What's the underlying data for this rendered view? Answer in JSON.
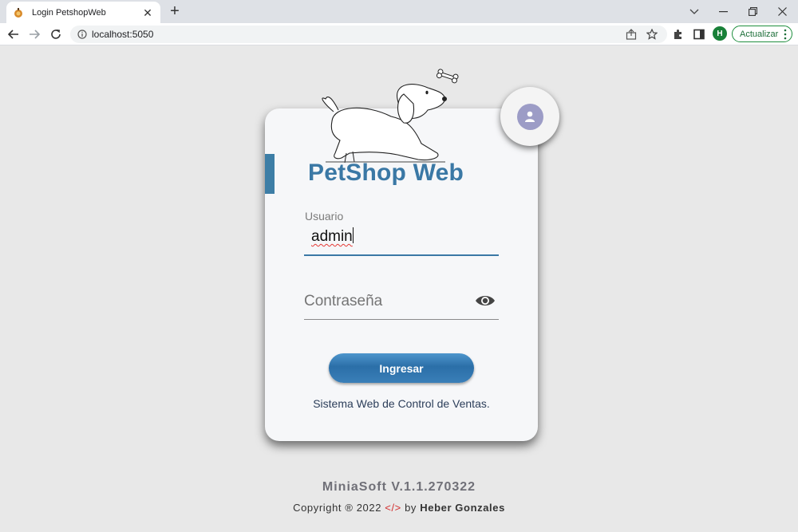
{
  "browser": {
    "tab_title": "Login PetshopWeb",
    "close_symbol": "✕",
    "newtab_symbol": "+",
    "url": "localhost:5050",
    "profile_initial": "H",
    "update_label": "Actualizar"
  },
  "login": {
    "brand": "PetShop Web",
    "username_label": "Usuario",
    "username_value": "admin",
    "password_placeholder": "Contraseña",
    "submit_label": "Ingresar",
    "subtitle": "Sistema Web de Control de Ventas."
  },
  "footer": {
    "version": "MiniaSoft V.1.1.270322",
    "copyright_prefix": "Copyright ® 2022",
    "code_symbol": "</>",
    "by": "by",
    "author": "Heber Gonzales"
  },
  "colors": {
    "accent": "#3a78a5",
    "avatar": "#9c9cc6",
    "page_bg": "#e8e8e8",
    "update_green": "#1e8e3e"
  },
  "icons": [
    "tab-favicon-icon",
    "close-icon",
    "plus-icon",
    "chevron-down-icon",
    "minimize-icon",
    "restore-icon",
    "window-close-icon",
    "back-arrow-icon",
    "forward-arrow-icon",
    "reload-icon",
    "info-icon",
    "share-icon",
    "star-icon",
    "extensions-icon",
    "side-panel-icon",
    "kebab-menu-icon",
    "dog-illustration-icon",
    "user-avatar-icon",
    "eye-icon"
  ]
}
